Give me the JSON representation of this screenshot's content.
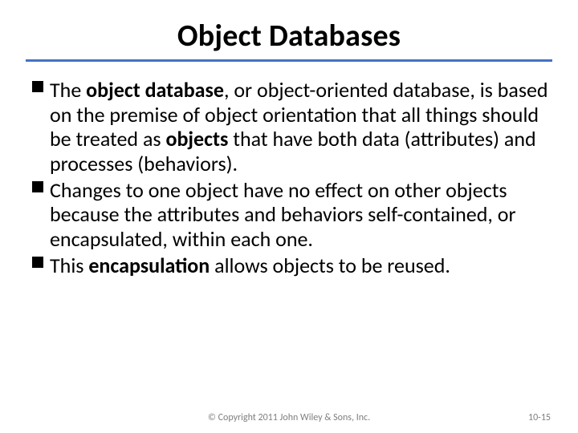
{
  "title": "Object Databases",
  "bullets": [
    {
      "runs": [
        {
          "t": "The ",
          "b": false
        },
        {
          "t": "object database",
          "b": true
        },
        {
          "t": ", or object-oriented database, is based on the premise of object orientation that all things should be treated as ",
          "b": false
        },
        {
          "t": "objects",
          "b": true
        },
        {
          "t": " that have both data (attributes) and processes (behaviors).",
          "b": false
        }
      ]
    },
    {
      "runs": [
        {
          "t": "Changes to one object have no effect on other objects because the attributes and behaviors self-contained, or encapsulated, within each one.",
          "b": false
        }
      ]
    },
    {
      "runs": [
        {
          "t": "This ",
          "b": false
        },
        {
          "t": "encapsulation",
          "b": true
        },
        {
          "t": " allows objects to be reused.",
          "b": false
        }
      ]
    }
  ],
  "footer": {
    "copyright": "© Copyright 2011 John Wiley & Sons, Inc.",
    "page": "10-15"
  }
}
